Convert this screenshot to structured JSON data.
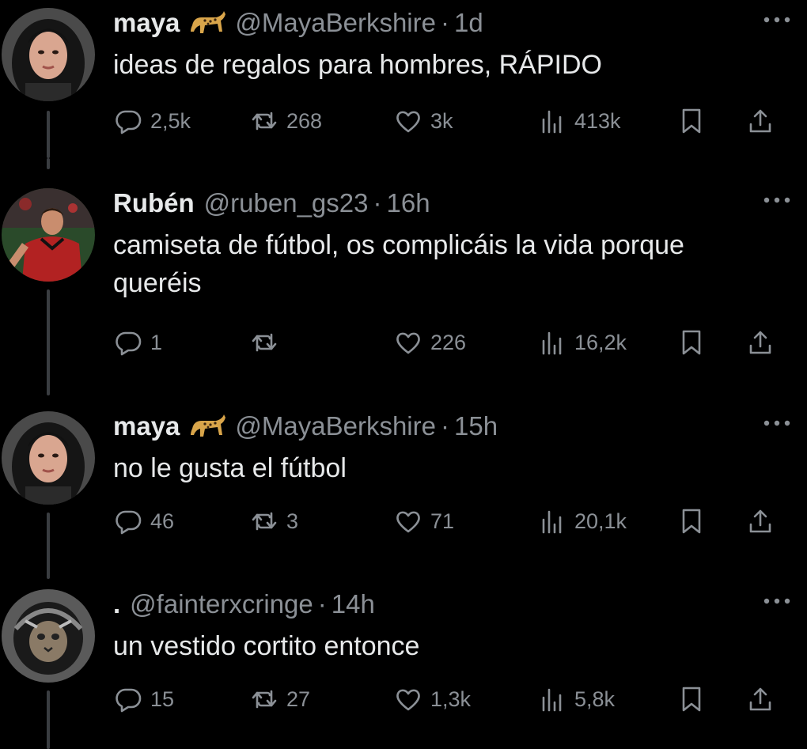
{
  "tweets": [
    {
      "name": "maya",
      "emoji": "leopard",
      "handle": "@MayaBerkshire",
      "separator": "·",
      "time": "1d",
      "text": "ideas de regalos para hombres, RÁPIDO",
      "replies": "2,5k",
      "retweets": "268",
      "likes": "3k",
      "views": "413k"
    },
    {
      "name": "Rubén",
      "emoji": "",
      "handle": "@ruben_gs23",
      "separator": "·",
      "time": "16h",
      "text": "camiseta de fútbol, os complicáis la vida porque queréis",
      "replies": "1",
      "retweets": "",
      "likes": "226",
      "views": "16,2k"
    },
    {
      "name": "maya",
      "emoji": "leopard",
      "handle": "@MayaBerkshire",
      "separator": "·",
      "time": "15h",
      "text": "no le gusta el fútbol",
      "replies": "46",
      "retweets": "3",
      "likes": "71",
      "views": "20,1k"
    },
    {
      "name": ".",
      "emoji": "",
      "handle": "@fainterxcringe",
      "separator": "·",
      "time": "14h",
      "text": "un vestido cortito entonce",
      "replies": "15",
      "retweets": "27",
      "likes": "1,3k",
      "views": "5,8k"
    }
  ],
  "icons": {
    "more": "more-horizontal-icon",
    "reply": "reply-bubble-icon",
    "retweet": "retweet-icon",
    "like": "heart-icon",
    "views": "bar-chart-icon",
    "bookmark": "bookmark-icon",
    "share": "share-upload-icon",
    "emoji": "leopard-emoji-icon"
  },
  "colors": {
    "background": "#000000",
    "primary_text": "#e7e9ea",
    "secondary_text": "#8b9096",
    "thread_line": "#3a3d41"
  }
}
